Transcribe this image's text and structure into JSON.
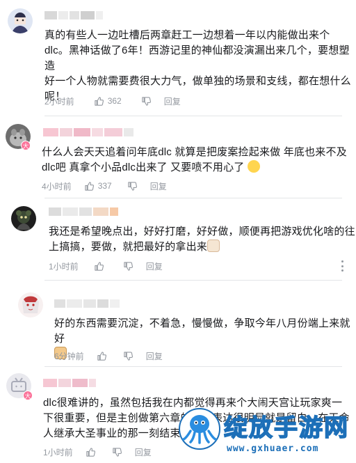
{
  "comments": [
    {
      "text_lines": [
        "真的有些人一边吐槽后两章赶工一边想着一年以内能做出来个",
        "dlc。黑神话做了6年！西游记里的神仙都没演漏出来几个，要想塑造",
        "好一个人物就需要费很大力气，做单独的场景和支线，都在想什么",
        "呢！"
      ],
      "time": "2小时前",
      "likes": "362",
      "reply": "回复"
    },
    {
      "text_lines": [
        "什么人会天天追着问年底dlc 就算是把废案捡起来做 年底也来不及",
        "dlc吧 真拿个小品dlc出来了 又要喷不用心了"
      ],
      "time": "4小时前",
      "likes": "337",
      "reply": "回复"
    },
    {
      "text_lines": [
        "我还是希望晚点出，好好打磨，好好做，顺便再把游戏优化啥的往",
        "上搞搞，要做，就把最好的拿出来"
      ],
      "time": "1小时前",
      "likes": "",
      "reply": "回复"
    },
    {
      "text_lines": [
        "好的东西需要沉淀，不着急，慢慢做，争取今年八月份端上来就好",
        ""
      ],
      "time": "6分钟前",
      "likes": "",
      "reply": "回复"
    },
    {
      "text_lines": [
        "dlc很难讲的，虽然包括我在内都觉得再来个大闹天宫让玩家爽一",
        "下很重要，但是主创做第六章的艺术表达很明显就是留白，在天命",
        "人继承大圣事业的那一刻结束是最"
      ],
      "time": "1小时前",
      "likes": "",
      "reply": "回复"
    }
  ],
  "icons": {
    "like": "thumbs-up-icon",
    "dislike": "thumbs-down-icon",
    "more": "more-vertical-icon",
    "vip": "vip-badge-icon"
  },
  "vip_badge": "大",
  "watermark": {
    "title": "绽放手游网",
    "url": "www.gxhuaer.com"
  },
  "colors": {
    "meta": "#9499a0",
    "text": "#18191c",
    "vip": "#fb7299",
    "watermark": "#1c6fb8"
  }
}
